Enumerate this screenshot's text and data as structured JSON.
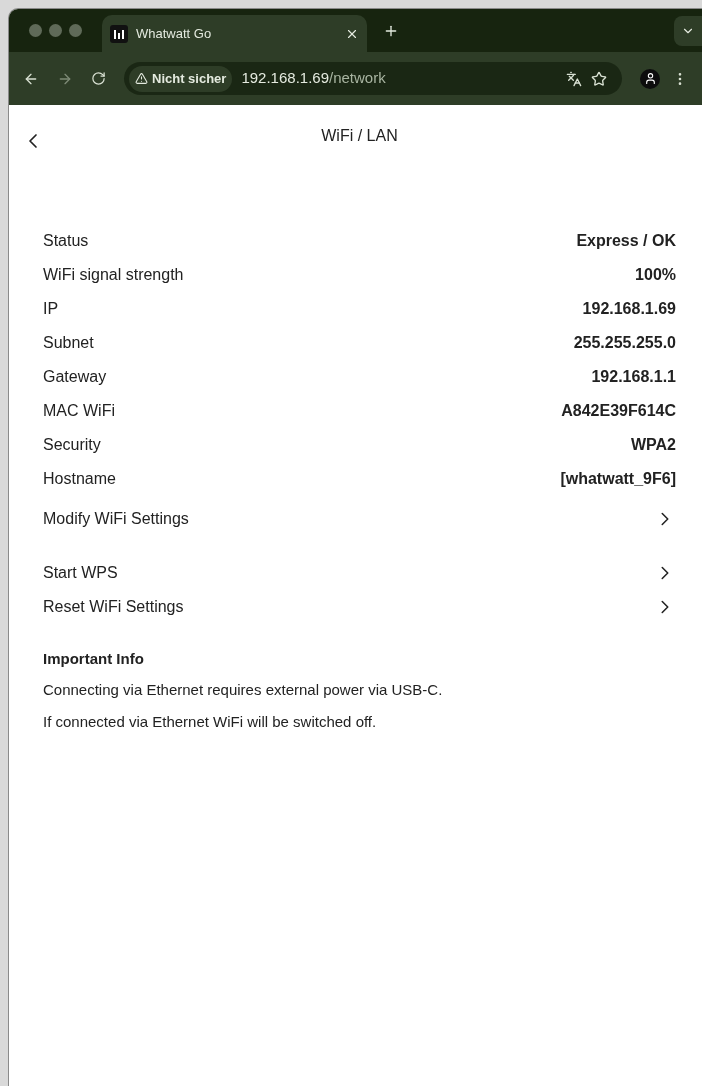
{
  "browser": {
    "tab": {
      "title": "Whatwatt Go",
      "selected": true
    },
    "security": "Nicht sicher",
    "url_host": "192.168.1.69",
    "url_path": "/network"
  },
  "page": {
    "title": "WiFi / LAN",
    "details": [
      {
        "label": "Status",
        "value": "Express / OK"
      },
      {
        "label": "WiFi signal strength",
        "value": "100%"
      },
      {
        "label": "IP",
        "value": "192.168.1.69"
      },
      {
        "label": "Subnet",
        "value": "255.255.255.0"
      },
      {
        "label": "Gateway",
        "value": "192.168.1.1"
      },
      {
        "label": "MAC WiFi",
        "value": "A842E39F614C"
      },
      {
        "label": "Security",
        "value": "WPA2"
      },
      {
        "label": "Hostname",
        "value": "[whatwatt_9F6]"
      }
    ],
    "actions": [
      {
        "label": "Modify WiFi Settings"
      },
      {
        "label": "Start WPS"
      },
      {
        "label": "Reset WiFi Settings"
      }
    ],
    "info": {
      "title": "Important Info",
      "lines": [
        "Connecting via Ethernet requires external power via USB-C.",
        "If connected via Ethernet WiFi will be switched off."
      ]
    }
  }
}
